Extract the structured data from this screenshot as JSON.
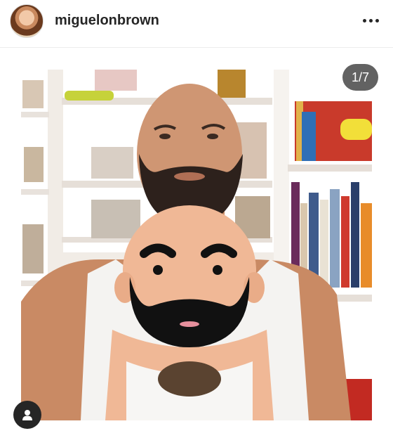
{
  "post": {
    "username": "miguelonbrown",
    "counter": "1/7"
  },
  "icons": {
    "more": "more-horizontal-icon",
    "tag": "user-tag-icon"
  },
  "colors": {
    "text": "#262626",
    "counter_bg": "#262626",
    "divider": "#ececec"
  }
}
